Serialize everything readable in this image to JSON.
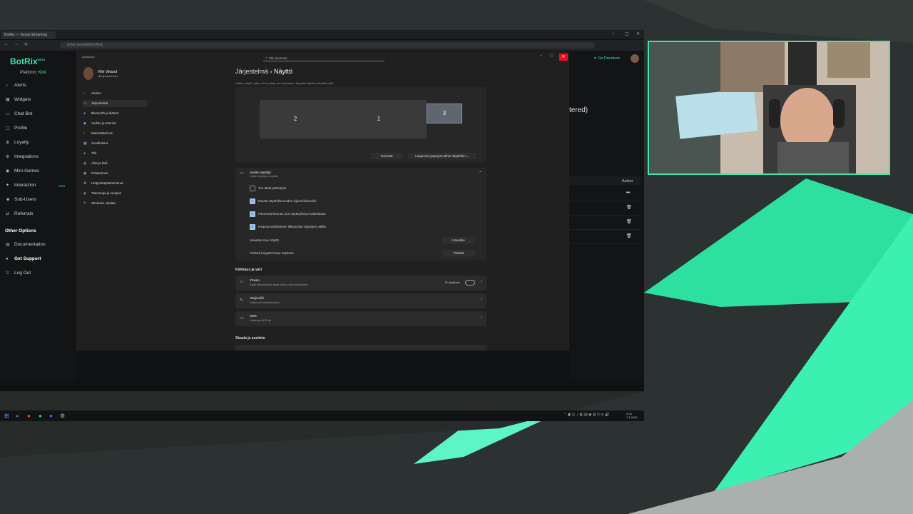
{
  "browser": {
    "tab_title": "BotRix — Smart Streaming",
    "url": "botrix.live/platform/kick"
  },
  "botrix": {
    "logo": "BotRix",
    "logo_badge": "BETA",
    "platform_label": "Platform:",
    "platform_value": "Kick",
    "nav": [
      {
        "label": "Alerts",
        "icon": "bell-icon"
      },
      {
        "label": "Widgets",
        "icon": "widgets-icon"
      },
      {
        "label": "Chat Bot",
        "icon": "chat-icon"
      },
      {
        "label": "Profile",
        "icon": "profile-icon"
      },
      {
        "label": "Loyalty",
        "icon": "trophy-icon"
      },
      {
        "label": "Integrations",
        "icon": "integrations-icon"
      },
      {
        "label": "Mini-Games",
        "icon": "gamepad-icon"
      },
      {
        "label": "Interaction",
        "icon": "interaction-icon",
        "badge": "NEW"
      },
      {
        "label": "Sub-Users",
        "icon": "users-icon"
      },
      {
        "label": "Referrals",
        "icon": "referrals-icon"
      }
    ],
    "other_options_title": "Other Options",
    "other": [
      {
        "label": "Documentation",
        "icon": "docs-icon"
      },
      {
        "label": "Get Support",
        "icon": "support-icon"
      },
      {
        "label": "Log Out",
        "icon": "logout-icon"
      }
    ],
    "go_premium": "Go Premium",
    "partial_heading": "tered)",
    "table_action_header": "Action"
  },
  "settings": {
    "window_title": "Asetukset",
    "search_placeholder": "Etsi asetusta",
    "user_name": "Ville Viklund",
    "user_email": "ville@outlook.com",
    "nav": [
      {
        "label": "Aloitus"
      },
      {
        "label": "Järjestelmä",
        "active": true
      },
      {
        "label": "Bluetooth ja laitteet"
      },
      {
        "label": "Verkko ja Internet"
      },
      {
        "label": "Mukauttaminen"
      },
      {
        "label": "Sovellukset"
      },
      {
        "label": "Tilit"
      },
      {
        "label": "Aika ja kieli"
      },
      {
        "label": "Pelaaminen"
      },
      {
        "label": "Helppokäyttötoiminnot"
      },
      {
        "label": "Tietosuoja ja suojaus"
      },
      {
        "label": "Windows Update"
      }
    ],
    "breadcrumb_parent": "Järjestelmä",
    "breadcrumb_sep": "›",
    "breadcrumb_current": "Näyttö",
    "description": "Valitse näyttö, jotta voit muuttaa sen asetuksia. Järjestä näytöt vetämällä niitä.",
    "monitors": [
      "2",
      "1",
      "3"
    ],
    "identify_label": "Tunnista",
    "extend_label": "Laajenna työpöytä näihin näyttöihin",
    "multi_display": {
      "title": "Useita näyttöjä",
      "subtitle": "Valitse näyttöjen esitystila",
      "options": [
        {
          "label": "Tee tästä päänäyttö",
          "checked": false
        },
        {
          "label": "Muista näyttöikkunoiden sijainti ikkunoille",
          "checked": true
        },
        {
          "label": "Pienennä ikkunat, kun näyttöyhteys katkaistaan",
          "checked": true
        },
        {
          "label": "Helpota kohdistimen liikkumista näyttöjen välillä",
          "checked": true
        }
      ],
      "detect_row_label": "Havaitse muu näyttö",
      "detect_button": "Havaitse",
      "wireless_row_label": "Yhdistä langattomaan näyttöön",
      "wireless_button": "Yhdistä"
    },
    "brightness_section_title": "Kirkkaus ja väri",
    "cards": [
      {
        "title": "Yövalo",
        "subtitle": "Käytä lämpimämpiä värejä sinisen valon estämiseksi",
        "status": "Ei käytössä",
        "icon": "sun-icon"
      },
      {
        "title": "Väriprofiili",
        "subtitle": "Valitse värit väriasetuksista",
        "icon": "pen-icon"
      },
      {
        "title": "HDR",
        "subtitle": "Lisätietoja HDR:stä",
        "icon": "hdr-icon"
      }
    ],
    "scale_section_title": "Skaala ja asettelu"
  },
  "taskbar": {
    "clock_time": "0.00",
    "clock_date": "1.1.2024"
  }
}
